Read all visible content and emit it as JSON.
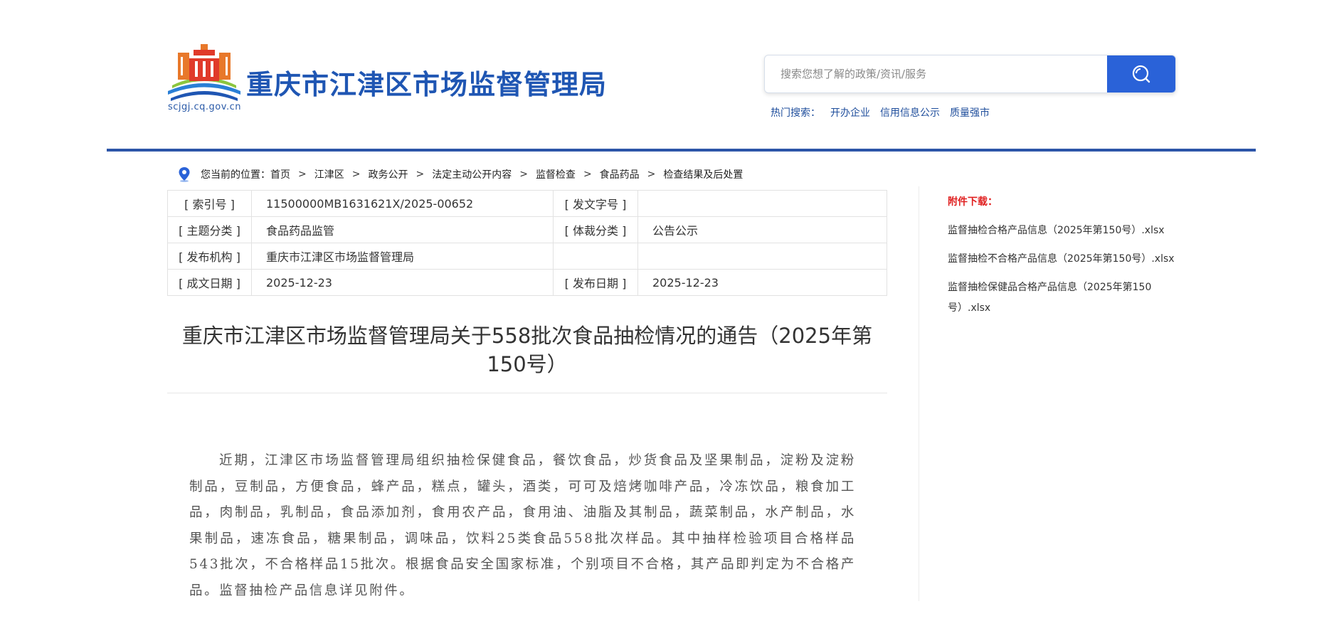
{
  "header": {
    "site_title": "重庆市江津区市场监督管理局",
    "site_url": "scjgj.cq.gov.cn",
    "search_placeholder": "搜索您想了解的政策/资讯/服务",
    "hot_label": "热门搜索：",
    "hot_links": [
      "开办企业",
      "信用信息公示",
      "质量强市"
    ]
  },
  "colors": {
    "brand_blue": "#1f56b3",
    "search_button": "#2a62d8",
    "attachment_head": "#e02020"
  },
  "breadcrumb": {
    "prefix": "您当前的位置：",
    "items": [
      "首页",
      "江津区",
      "政务公开",
      "法定主动公开内容",
      "监督检查",
      "食品药品",
      "检查结果及后处置"
    ],
    "separator": ">"
  },
  "meta": {
    "rows": [
      {
        "k1": "[ 索引号 ]",
        "v1": "11500000MB1631621X/2025-00652",
        "k2": "[ 发文字号 ]",
        "v2": ""
      },
      {
        "k1": "[ 主题分类 ]",
        "v1": "食品药品监管",
        "k2": "[ 体裁分类 ]",
        "v2": "公告公示"
      },
      {
        "k1": "[ 发布机构 ]",
        "v1": "重庆市江津区市场监督管理局",
        "k2": "",
        "v2": ""
      },
      {
        "k1": "[ 成文日期 ]",
        "v1": "2025-12-23",
        "k2": "[ 发布日期 ]",
        "v2": "2025-12-23"
      }
    ]
  },
  "article": {
    "title": "重庆市江津区市场监督管理局关于558批次食品抽检情况的通告（2025年第150号）",
    "body": "近期，江津区市场监督管理局组织抽检保健食品，餐饮食品，炒货食品及坚果制品，淀粉及淀粉制品，豆制品，方便食品，蜂产品，糕点，罐头，酒类，可可及焙烤咖啡产品，冷冻饮品，粮食加工品，肉制品，乳制品，食品添加剂，食用农产品，食用油、油脂及其制品，蔬菜制品，水产制品，水果制品，速冻食品，糖果制品，调味品，饮料25类食品558批次样品。其中抽样检验项目合格样品543批次，不合格样品15批次。根据食品安全国家标准，个别项目不合格，其产品即判定为不合格产品。监督抽检产品信息详见附件。"
  },
  "attachments": {
    "heading": "附件下载：",
    "files": [
      "监督抽检合格产品信息（2025年第150号）.xlsx",
      "监督抽检不合格产品信息（2025年第150号）.xlsx",
      "监督抽检保健品合格产品信息（2025年第150号）.xlsx"
    ]
  },
  "icons": {
    "search": "search-icon",
    "location": "location-pin-icon",
    "logo": "tiananmen-logo-icon"
  }
}
